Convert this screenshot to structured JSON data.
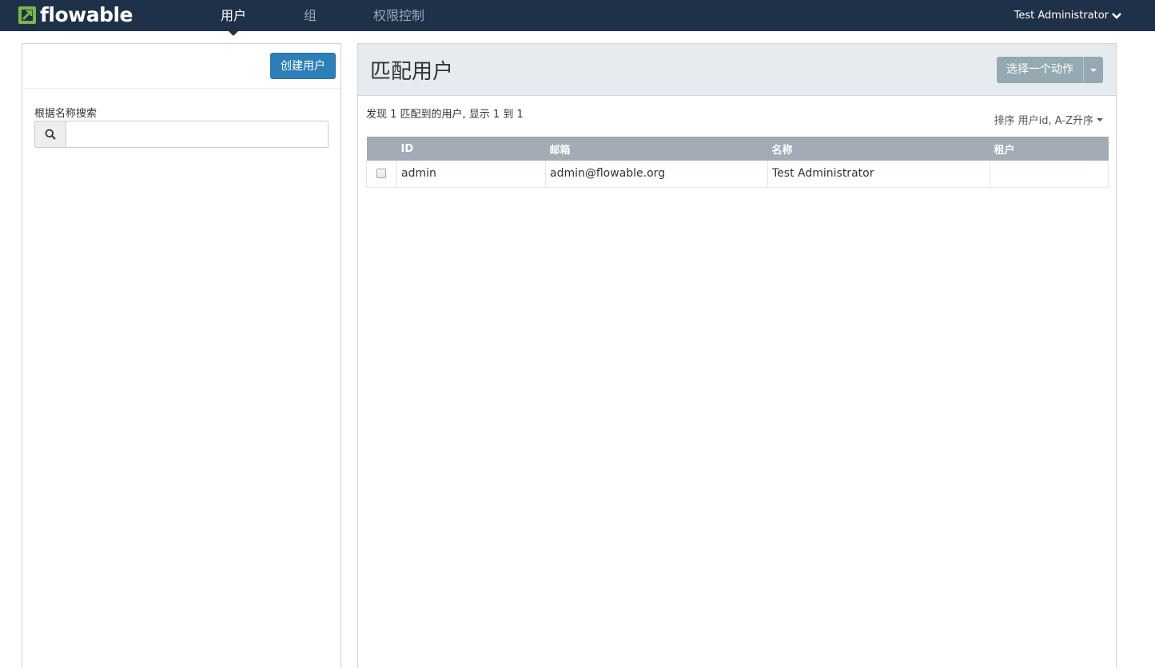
{
  "app": {
    "logo_text": "flowable",
    "brand_color": "#7ab648"
  },
  "nav": {
    "items": [
      {
        "label": "用户",
        "active": true
      },
      {
        "label": "组",
        "active": false
      },
      {
        "label": "权限控制",
        "active": false
      }
    ],
    "user_name": "Test Administrator"
  },
  "sidebar": {
    "create_button": "创建用户",
    "search_label": "根据名称搜索",
    "search_value": "",
    "search_icon": "search-icon"
  },
  "main": {
    "title": "匹配用户",
    "action_button": "选择一个动作",
    "result_text": "发现 1 匹配到的用户, 显示 1 到 1",
    "sort_text": "排序 用户id, A-Z升序",
    "table": {
      "headers": [
        "ID",
        "邮箱",
        "名称",
        "租户"
      ],
      "rows": [
        {
          "id": "admin",
          "email": "admin@flowable.org",
          "name": "Test Administrator",
          "tenant": "",
          "checked": false
        }
      ]
    }
  }
}
